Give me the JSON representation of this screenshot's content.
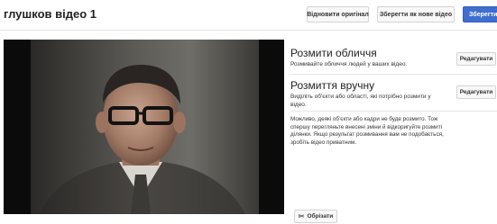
{
  "header": {
    "title": "глушков відео 1",
    "revert_label": "Відновити оригінал",
    "save_as_new_label": "Зберегти як нове відео",
    "save_label": "Зберегти"
  },
  "panel": {
    "blur_faces": {
      "title": "Розмити обличчя",
      "description": "Розмивайте обличчя людей у ваших відео.",
      "edit_label": "Редагувати"
    },
    "custom_blur": {
      "title": "Розмиття вручну",
      "description": "Виділіть об'єкти або області, які потрібно розмити у відео.",
      "edit_label": "Редагувати"
    },
    "note": "Можливо, деякі об'єкти або кадри не буде розмито. Тож спершу перегляньте внесені зміни й відкоригуйте розмиті ділянки. Якщо результат розмивання вам не подобається, зробіть відео приватним.",
    "trim_label": "Обрізати",
    "trim_icon": "scissors-icon"
  },
  "colors": {
    "accent": "#3f6ecf",
    "video_bg": "#0b0b0b"
  }
}
